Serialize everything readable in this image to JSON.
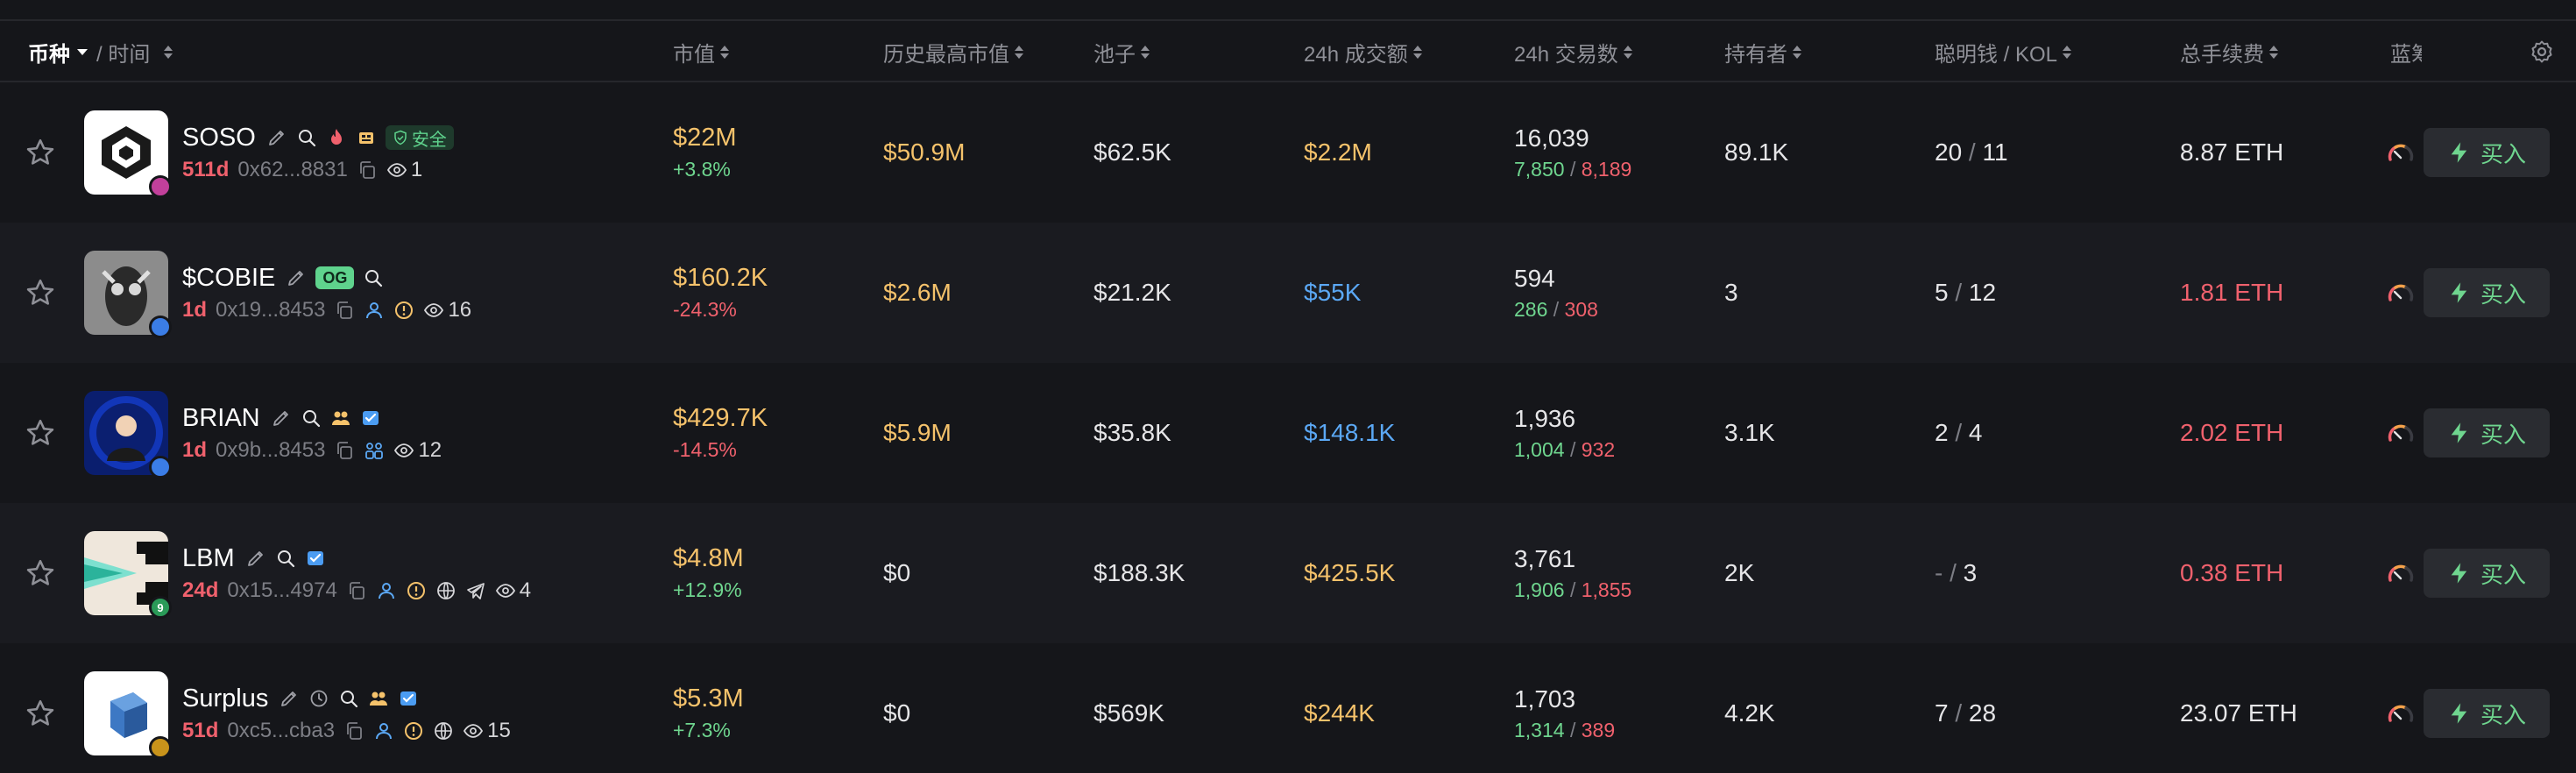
{
  "header": {
    "coin": "币种",
    "time": "/ 时间",
    "market_cap": "市值",
    "ath_mc": "历史最高市值",
    "pool": "池子",
    "vol_24h": "24h 成交额",
    "tx_24h": "24h 交易数",
    "holders": "持有者",
    "smart_kol": "聪明钱 / KOL",
    "total_fee": "总手续费",
    "bluechip": "蓝筹"
  },
  "colors": {
    "gold": "#f5c26b",
    "green": "#6fd68f",
    "red": "#f0616d",
    "blue": "#5ba8f5"
  },
  "buy_label": "买入",
  "rows": [
    {
      "symbol": "SOSO",
      "badge": "安全",
      "age": "511d",
      "addr": "0x62...8831",
      "views": "1",
      "market_cap": "$22M",
      "change": "+3.8%",
      "change_dir": "pos",
      "ath": "$50.9M",
      "ath_color": "gold",
      "pool": "$62.5K",
      "volume": "$2.2M",
      "volume_color": "gold",
      "tx": "16,039",
      "buys": "7,850",
      "sells": "8,189",
      "holders": "89.1K",
      "smart": "20",
      "kol": "11",
      "fee": "8.87 ETH",
      "fee_color": "white",
      "icons": [
        "edit-icon",
        "search-icon",
        "fire-icon",
        "trophy-icon"
      ]
    },
    {
      "symbol": "$COBIE",
      "badge": "OG",
      "age": "1d",
      "addr": "0x19...8453",
      "views": "16",
      "market_cap": "$160.2K",
      "change": "-24.3%",
      "change_dir": "neg",
      "ath": "$2.6M",
      "ath_color": "gold",
      "pool": "$21.2K",
      "volume": "$55K",
      "volume_color": "blue",
      "tx": "594",
      "buys": "286",
      "sells": "308",
      "holders": "3",
      "smart": "5",
      "kol": "12",
      "fee": "1.81 ETH",
      "fee_color": "red",
      "icons": [
        "edit-icon",
        "search-icon"
      ]
    },
    {
      "symbol": "BRIAN",
      "badge": "",
      "age": "1d",
      "addr": "0x9b...8453",
      "views": "12",
      "market_cap": "$429.7K",
      "change": "-14.5%",
      "change_dir": "neg",
      "ath": "$5.9M",
      "ath_color": "gold",
      "pool": "$35.8K",
      "volume": "$148.1K",
      "volume_color": "blue",
      "tx": "1,936",
      "buys": "1,004",
      "sells": "932",
      "holders": "3.1K",
      "smart": "2",
      "kol": "4",
      "fee": "2.02 ETH",
      "fee_color": "red",
      "icons": [
        "edit-icon",
        "search-icon",
        "group-icon",
        "verified-icon"
      ]
    },
    {
      "symbol": "LBM",
      "badge": "",
      "age": "24d",
      "addr": "0x15...4974",
      "views": "4",
      "market_cap": "$4.8M",
      "change": "+12.9%",
      "change_dir": "pos",
      "ath": "$0",
      "ath_color": "white",
      "pool": "$188.3K",
      "volume": "$425.5K",
      "volume_color": "gold",
      "tx": "3,761",
      "buys": "1,906",
      "sells": "1,855",
      "holders": "2K",
      "smart": "-",
      "kol": "3",
      "fee": "0.38 ETH",
      "fee_color": "red",
      "icons": [
        "edit-icon",
        "search-icon",
        "verified-icon"
      ]
    },
    {
      "symbol": "Surplus",
      "badge": "",
      "age": "51d",
      "addr": "0xc5...cba3",
      "views": "15",
      "market_cap": "$5.3M",
      "change": "+7.3%",
      "change_dir": "pos",
      "ath": "$0",
      "ath_color": "white",
      "pool": "$569K",
      "volume": "$244K",
      "volume_color": "gold",
      "tx": "1,703",
      "buys": "1,314",
      "sells": "389",
      "holders": "4.2K",
      "smart": "7",
      "kol": "28",
      "fee": "23.07 ETH",
      "fee_color": "white",
      "icons": [
        "edit-icon",
        "clock-icon",
        "search-icon",
        "group-icon",
        "verified-icon"
      ]
    }
  ]
}
